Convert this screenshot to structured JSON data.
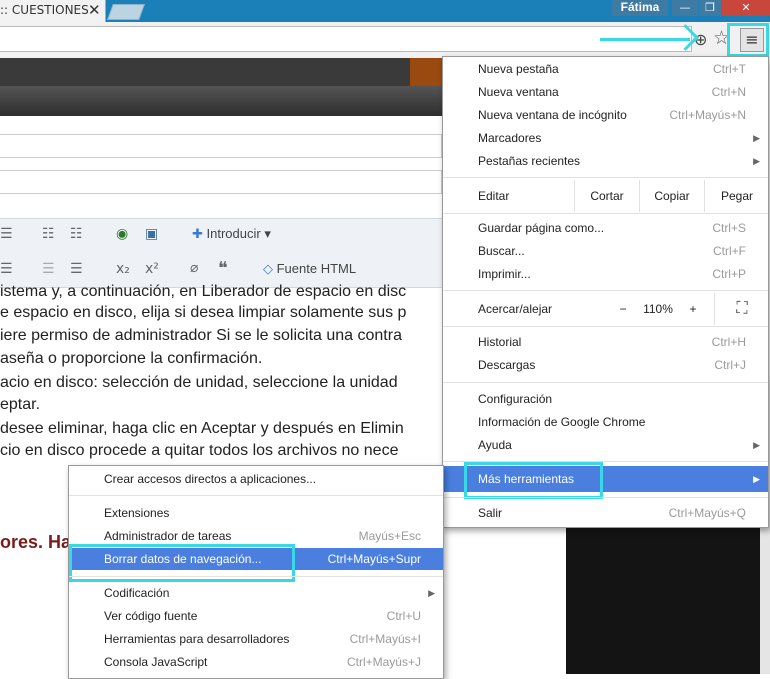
{
  "tab": {
    "title": ":: CUESTIONES",
    "close": "✕"
  },
  "window": {
    "user": "Fátima",
    "minimize": "—",
    "maximize": "❐",
    "close": "✕"
  },
  "toolbar": {
    "zoom_icon": "⊕",
    "star_icon": "☆",
    "menu_icon": "≡"
  },
  "editor_toolbar": {
    "insert_label": "Introducir",
    "html_label": "Fuente HTML"
  },
  "page_text": [
    "istema y, a continuación, en Liberador de espacio en disc",
    "e espacio en disco, elija si desea limpiar solamente sus p",
    "iere permiso de administrador Si se le solicita una contra",
    "aseña o proporcione la confirmación.",
    "acio en disco: selección de unidad, seleccione la unidad",
    "eptar.",
    "desee eliminar, haga clic en Aceptar y después en Elimin",
    "cio en disco procede a quitar todos los archivos no nece"
  ],
  "page_heading": "ores. Ha",
  "main_menu": {
    "group1": [
      {
        "label": "Nueva pestaña",
        "shortcut": "Ctrl+T"
      },
      {
        "label": "Nueva ventana",
        "shortcut": "Ctrl+N"
      },
      {
        "label": "Nueva ventana de incógnito",
        "shortcut": "Ctrl+Mayús+N"
      },
      {
        "label": "Marcadores",
        "arrow": "▶"
      },
      {
        "label": "Pestañas recientes",
        "arrow": "▶"
      }
    ],
    "edit": {
      "label": "Editar",
      "cut": "Cortar",
      "copy": "Copiar",
      "paste": "Pegar"
    },
    "group2": [
      {
        "label": "Guardar página como...",
        "shortcut": "Ctrl+S"
      },
      {
        "label": "Buscar...",
        "shortcut": "Ctrl+F"
      },
      {
        "label": "Imprimir...",
        "shortcut": "Ctrl+P"
      }
    ],
    "zoom": {
      "label": "Acercar/alejar",
      "minus": "−",
      "value": "110%",
      "plus": "+",
      "fullscreen": "⛶"
    },
    "group3": [
      {
        "label": "Historial",
        "shortcut": "Ctrl+H"
      },
      {
        "label": "Descargas",
        "shortcut": "Ctrl+J"
      }
    ],
    "group4": [
      {
        "label": "Configuración"
      },
      {
        "label": "Información de Google Chrome"
      },
      {
        "label": "Ayuda",
        "arrow": "▶"
      }
    ],
    "more_tools": {
      "label": "Más herramientas",
      "arrow": "▶"
    },
    "exit": {
      "label": "Salir",
      "shortcut": "Ctrl+Mayús+Q"
    }
  },
  "sub_menu": {
    "create_shortcuts": "Crear accesos directos a aplicaciones...",
    "extensions": "Extensiones",
    "task_manager": {
      "label": "Administrador de tareas",
      "shortcut": "Mayús+Esc"
    },
    "clear_data": {
      "label": "Borrar datos de navegación...",
      "shortcut": "Ctrl+Mayús+Supr"
    },
    "encoding": {
      "label": "Codificación",
      "arrow": "▶"
    },
    "view_source": {
      "label": "Ver código fuente",
      "shortcut": "Ctrl+U"
    },
    "dev_tools": {
      "label": "Herramientas para desarrolladores",
      "shortcut": "Ctrl+Mayús+I"
    },
    "js_console": {
      "label": "Consola JavaScript",
      "shortcut": "Ctrl+Mayús+J"
    }
  },
  "colors": {
    "highlight": "#4a7fe0",
    "annotation": "#39d8e6",
    "tabstrip": "#1b7fb8"
  }
}
